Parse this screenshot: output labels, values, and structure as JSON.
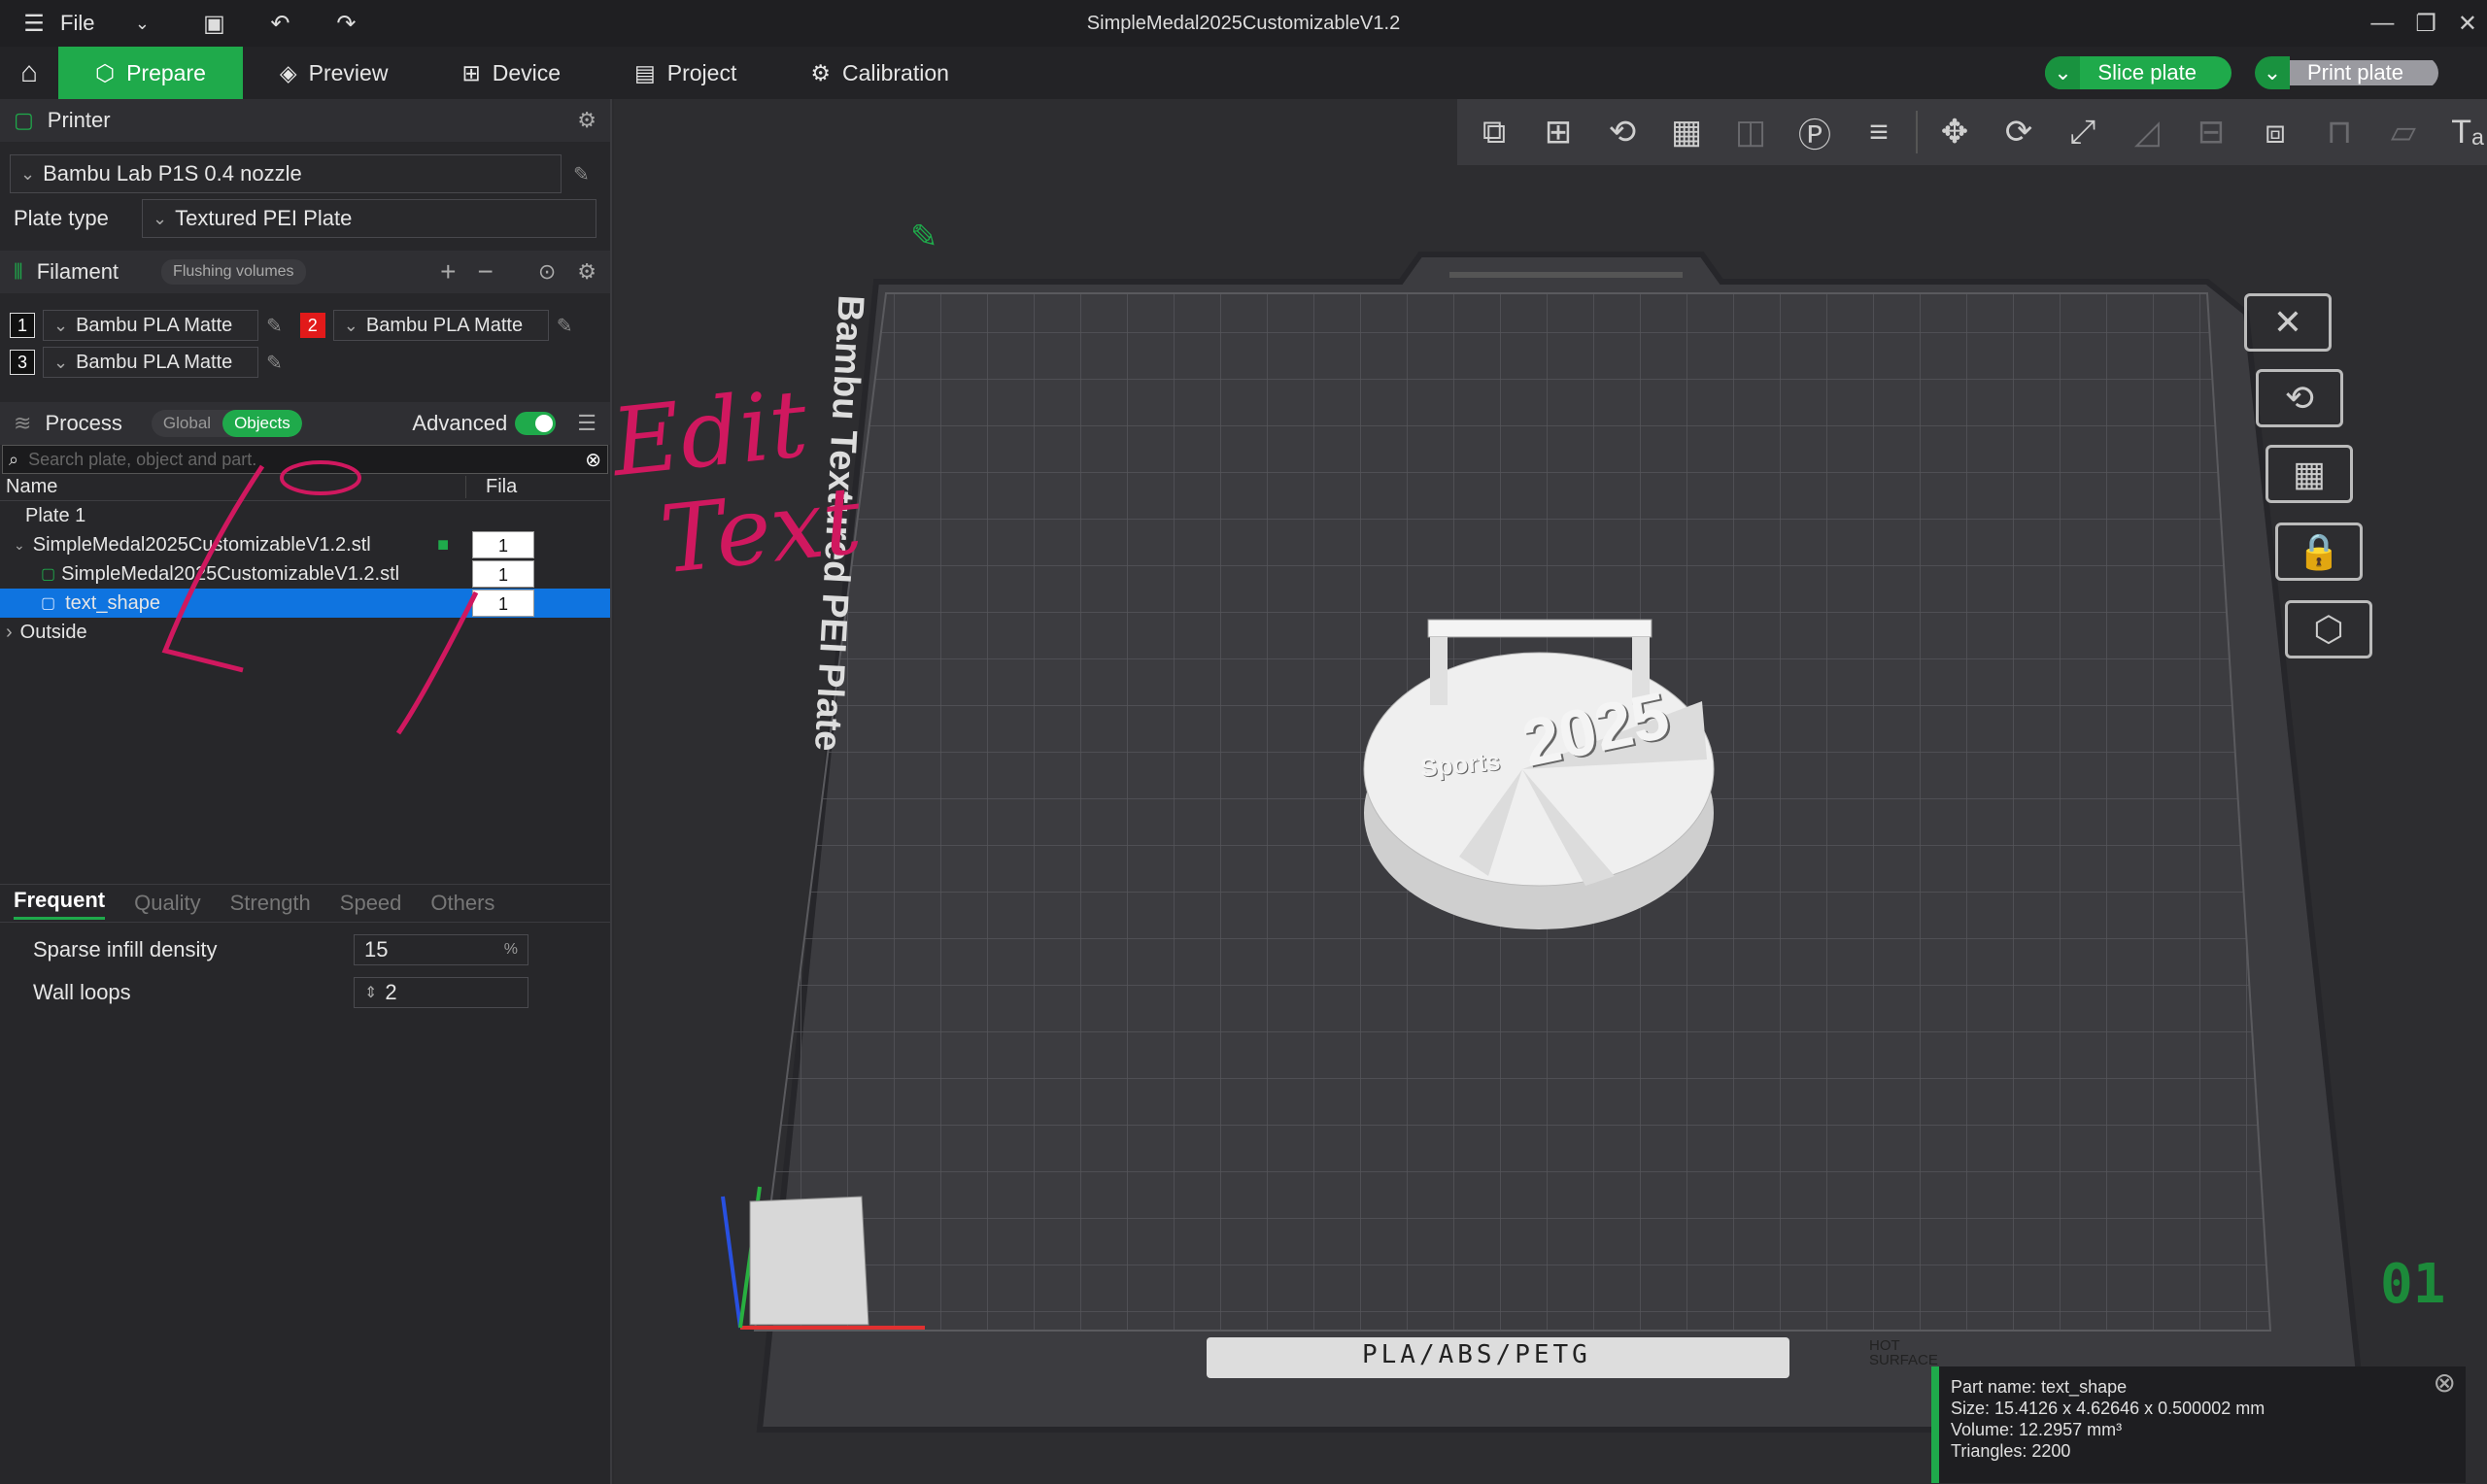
{
  "app": {
    "title": "SimpleMedal2025CustomizableV1.2",
    "file_menu": "File"
  },
  "tabs": [
    {
      "label": "Prepare"
    },
    {
      "label": "Preview"
    },
    {
      "label": "Device"
    },
    {
      "label": "Project"
    },
    {
      "label": "Calibration"
    }
  ],
  "actions": {
    "slice": "Slice plate",
    "print": "Print plate"
  },
  "printer": {
    "section": "Printer",
    "name": "Bambu Lab P1S 0.4 nozzle",
    "plate_type_label": "Plate type",
    "plate_type": "Textured PEI Plate"
  },
  "filament": {
    "section": "Filament",
    "flushing": "Flushing volumes",
    "items": [
      {
        "num": "1",
        "name": "Bambu PLA Matte",
        "color": "#111111"
      },
      {
        "num": "2",
        "name": "Bambu PLA Matte",
        "color": "#e21a1a"
      },
      {
        "num": "3",
        "name": "Bambu PLA Matte",
        "color": "#111111"
      }
    ]
  },
  "process": {
    "section": "Process",
    "global": "Global",
    "objects": "Objects",
    "advanced": "Advanced",
    "search_placeholder": "Search plate, object and part."
  },
  "tree": {
    "col_name": "Name",
    "col_fila": "Fila",
    "rows": [
      {
        "label": "Plate 1"
      },
      {
        "label": "SimpleMedal2025CustomizableV1.2.stl",
        "fila": "1"
      },
      {
        "label": "SimpleMedal2025CustomizableV1.2.stl",
        "fila": "1"
      },
      {
        "label": "text_shape",
        "fila": "1"
      },
      {
        "label": "Outside"
      }
    ]
  },
  "param_tabs": [
    "Frequent",
    "Quality",
    "Strength",
    "Speed",
    "Others"
  ],
  "params": [
    {
      "label": "Sparse infill density",
      "value": "15",
      "unit": "%"
    },
    {
      "label": "Wall loops",
      "value": "2"
    }
  ],
  "bed": {
    "label": "Bambu Textured PEI Plate",
    "materials": "PLA/ABS/PETG",
    "hot": "HOT SURFACE",
    "plate_number": "01"
  },
  "model": {
    "text1": "2025",
    "text2": "Sports"
  },
  "part_info": {
    "name": "Part name: text_shape",
    "size": "Size: 15.4126 x 4.62646 x 0.500002 mm",
    "volume": "Volume: 12.2957 mm³",
    "triangles": "Triangles: 2200"
  },
  "annotation": {
    "line1": "Edit",
    "line2": "Text"
  }
}
